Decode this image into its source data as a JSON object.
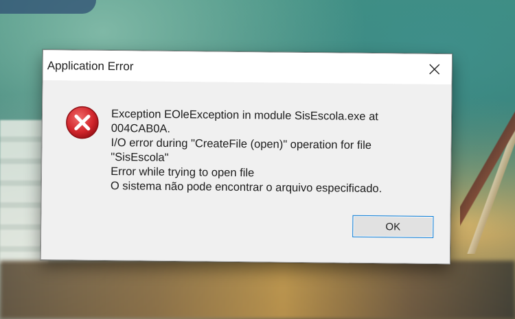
{
  "dialog": {
    "title": "Application Error",
    "icon": "error-x-icon",
    "message_lines": [
      "Exception EOleException in module SisEscola.exe at",
      "004CAB0A.",
      "I/O error during \"CreateFile (open)\" operation for file",
      "\"SisEscola\"",
      "Error while trying to open file",
      "O sistema não pode encontrar o arquivo especificado."
    ],
    "ok_label": "OK",
    "close_icon": "close-icon"
  },
  "colors": {
    "dialog_bg": "#f0f0f0",
    "titlebar_bg": "#ffffff",
    "error_red": "#d1252b",
    "button_border": "#0078d7"
  }
}
